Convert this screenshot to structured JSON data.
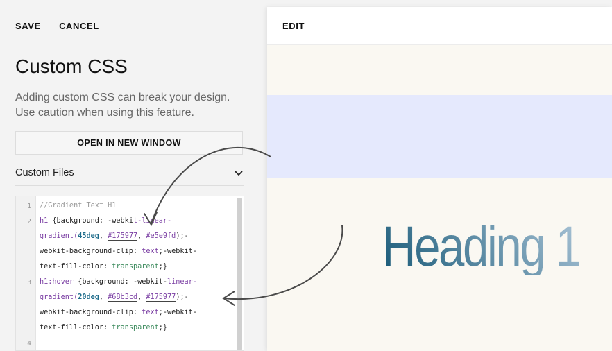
{
  "left_panel": {
    "toolbar": {
      "save_label": "SAVE",
      "cancel_label": "CANCEL"
    },
    "title": "Custom CSS",
    "description": "Adding custom CSS can break your design. Use caution when using this feature.",
    "open_window_label": "OPEN IN NEW WINDOW",
    "custom_files_label": "Custom Files",
    "chevron_icon": "chevron-down-icon"
  },
  "editor": {
    "line_numbers": [
      "1",
      "2",
      "3",
      "4"
    ],
    "comment": "//Gradient Text H1",
    "line2": {
      "selector": "h1",
      "prop_open": " {background: -webki",
      "value_start": "t-linear-",
      "fn": "gradient(",
      "deg": "45deg",
      "sep1": ", ",
      "color1": "#175977",
      "sep2": ", ",
      "color2": "#e5e9fd",
      "tail": ");-",
      "row3": "webkit-background-clip: ",
      "text_kw": "text",
      "row3_tail": ";-webkit-",
      "row4_prop": "text-fill-color: ",
      "transparent_kw": "transparent",
      "row4_tail": ";}"
    },
    "line3": {
      "selector": "h1:hover",
      "prop_open": " {background: -webkit-",
      "value_start": "linear-",
      "fn": "gradient(",
      "deg": "20deg",
      "sep1": ", ",
      "color1": "#68b3cd",
      "sep2": ", ",
      "color2": "#175977",
      "tail": ");-",
      "row3": "webkit-background-clip: ",
      "text_kw": "text",
      "row3_tail": ";-webkit-",
      "row4_prop": "text-fill-color: ",
      "transparent_kw": "transparent",
      "row4_tail": ";}"
    }
  },
  "preview": {
    "edit_label": "EDIT",
    "heading_text": "Heading 1",
    "band_color": "#e5e9fd",
    "gradient_start": "#175977"
  }
}
